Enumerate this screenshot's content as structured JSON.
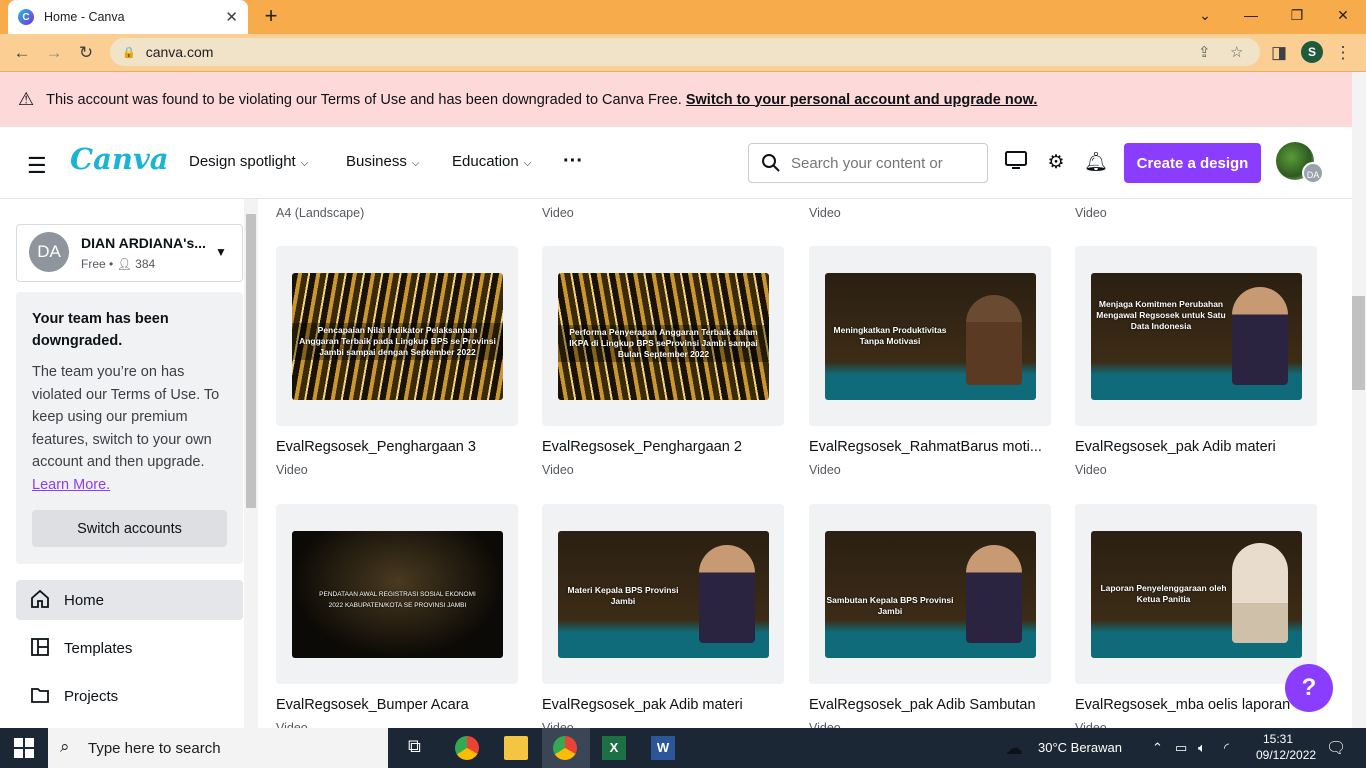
{
  "browser": {
    "tab_title": "Home - Canva",
    "url": "canva.com",
    "profile_initial": "S"
  },
  "banner": {
    "message": "This account was found to be violating our Terms of Use and has been downgraded to Canva Free.",
    "link": "Switch to your personal account and upgrade now."
  },
  "header": {
    "logo": "Canva",
    "nav": [
      "Design spotlight",
      "Business",
      "Education"
    ],
    "search_placeholder": "Search your content or",
    "create_label": "Create a design",
    "avatar_initials": "DA"
  },
  "sidebar": {
    "team_initials": "DA",
    "team_name": "DIAN ARDIANA's...",
    "team_plan": "Free",
    "team_members": "384",
    "downgrade_title": "Your team has been downgraded.",
    "downgrade_body": "The team you’re on has violated our Terms of Use. To keep using our premium features, switch to your own account and then upgrade.",
    "learn_more": "Learn More.",
    "switch_label": "Switch accounts",
    "nav": [
      {
        "label": "Home",
        "icon": "home-icon"
      },
      {
        "label": "Templates",
        "icon": "templates-icon"
      },
      {
        "label": "Projects",
        "icon": "folder-icon"
      }
    ]
  },
  "prev_row": [
    "A4 (Landscape)",
    "Video",
    "Video",
    "Video"
  ],
  "designs": [
    {
      "title": "EvalRegsosek_Penghargaan 3",
      "type": "Video",
      "thumb_text": "Pencapaian Nilai Indikator Pelaksanaan Anggaran Terbaik pada Lingkup BPS se Provinsi Jambi sampai dengan September 2022"
    },
    {
      "title": "EvalRegsosek_Penghargaan 2",
      "type": "Video",
      "thumb_text": "Performa Penyerapan Anggaran Terbaik dalam IKPA di Lingkup BPS seProvinsi Jambi sampai Bulan September 2022"
    },
    {
      "title": "EvalRegsosek_RahmatBarus moti...",
      "type": "Video",
      "thumb_text": "Meningkatkan Produktivitas Tanpa Motivasi"
    },
    {
      "title": "EvalRegsosek_pak Adib materi",
      "type": "Video",
      "thumb_text": "Menjaga Komitmen Perubahan Mengawal Regsosek untuk Satu Data Indonesia"
    },
    {
      "title": "EvalRegsosek_Bumper Acara",
      "type": "Video",
      "thumb_text": "PENDATAAN AWAL REGISTRASI SOSIAL EKONOMI 2022 KABUPATEN/KOTA SE PROVINSI JAMBI"
    },
    {
      "title": "EvalRegsosek_pak Adib materi",
      "type": "Video",
      "thumb_text": "Materi Kepala BPS Provinsi Jambi"
    },
    {
      "title": "EvalRegsosek_pak Adib Sambutan",
      "type": "Video",
      "thumb_text": "Sambutan Kepala BPS Provinsi Jambi"
    },
    {
      "title": "EvalRegsosek_mba oelis laporan",
      "type": "Video",
      "thumb_text": "Laporan Penyelenggaraan oleh Ketua Panitia"
    }
  ],
  "help_label": "?",
  "taskbar": {
    "search_placeholder": "Type here to search",
    "weather": "30°C  Berawan",
    "time": "15:31",
    "date": "09/12/2022"
  }
}
